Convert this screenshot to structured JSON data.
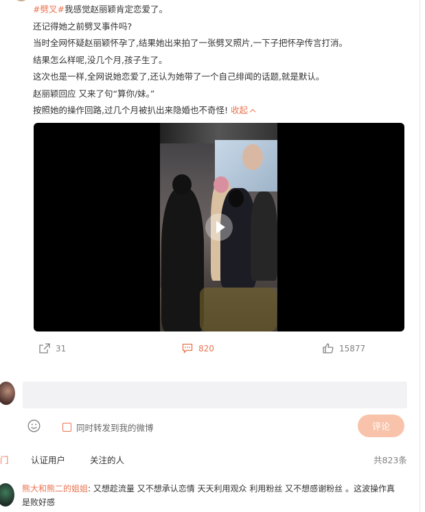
{
  "post": {
    "hashtag": "#劈叉#",
    "lines": [
      "我感觉赵丽颖肯定恋爱了。",
      "还记得她之前劈叉事件吗?",
      "当时全网怀疑赵丽颖怀孕了,结果她出来拍了一张劈叉照片,一下子把怀孕传言打消。",
      "结果怎么样呢,没几个月,孩子生了。",
      "这次也是一样,全网说她恋爱了,还认为她带了一个自己绯闻的话题,就是默认。",
      "赵丽颖回应 又来了句“算你/妹。”",
      "按照她的操作回路,过几个月被扒出来隐婚也不奇怪!"
    ],
    "collapse_label": "收起"
  },
  "actions": {
    "shares": "31",
    "comments": "820",
    "likes": "15877"
  },
  "composer": {
    "placeholder": "",
    "forward_label": "同时转发到我的微博",
    "submit_label": "评论"
  },
  "comment_filters": {
    "hot": "门",
    "verified": "认证用户",
    "followed": "关注的人",
    "total": "共823条"
  },
  "comments": [
    {
      "user": "熊大和熊二的姐姐",
      "separator": ":",
      "text_line1": "又想趁流量 又不想承认恋情 天天利用观众 利用粉丝 又不想感谢粉丝 。这波操作真",
      "text_line2": "是败好感"
    }
  ],
  "colors": {
    "accent": "#eb7350",
    "submit_bg": "#f8c3aa",
    "input_bg": "#f2f2f5",
    "muted": "#808080"
  },
  "icons": [
    "share-icon",
    "comment-icon",
    "like-icon",
    "emoji-icon",
    "play-icon",
    "chevron-up-icon"
  ]
}
